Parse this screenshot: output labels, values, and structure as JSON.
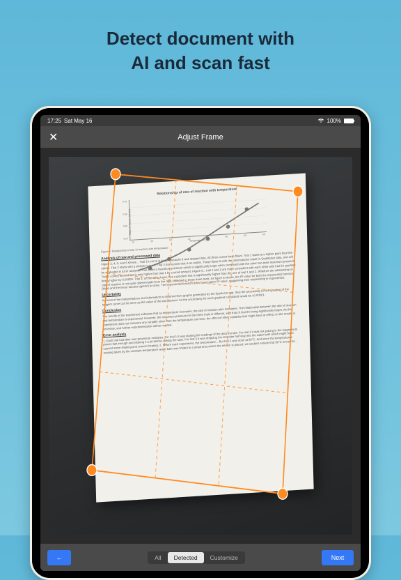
{
  "headline": {
    "line1": "Detect document with",
    "line2": "AI  and scan fast"
  },
  "status_bar": {
    "time": "17:25",
    "date": "Sat May 16",
    "battery_pct": "100%"
  },
  "nav": {
    "title": "Adjust Frame",
    "close_glyph": "✕"
  },
  "segments": {
    "all": "All",
    "detected": "Detected",
    "customize": "Customize"
  },
  "buttons": {
    "back_glyph": "←",
    "next": "Next"
  },
  "document": {
    "chart_caption": "Figure 6: Relationship of rate of reaction with temperature",
    "sec1_heading": "Analysis of raw and processed data",
    "sec1_body": "Figure 3, 4, 5, and 6 shows... Trial 1's curve is longer because it was stopped late. All three curves have flaws. Trial 1 starts at a higher point than the others. Trial 2 starts with a steeper curve... Trial 3 has a point that is an outlier. These flaws fit with the observations made in Qualitative data, and will be evaluated in Error analysis. Trial 3 has a maximum pressure which is significantly large when compared with the other two trials maximum pressure. Trial 2 comes second but is only higher than trial 1 by a small amount. Figure 6... trial 1 and 2 are more consistent with each other with trial 2's gradient being higher by 0.00009. Trial 3, on the other hand, has a gradient that is significantly higher than the one of trial 1 and 2. Whether the relationship of rate of reaction is not quite determinable from the data collected in these three trials. As figure 6 shows, the R² value for both the exponential function (blue) and the linear function (green) is close. The exponential function does have higher R² value, suggesting their relationship is exponential.",
    "sec2_heading": "Uncertainty",
    "sec2_body": "As most of the interpretations and information is obtained from graphs generated by the Sparkvue app, thus the uncertainty for the gradient of the tangent curve can be seen as the value of the last decimal. So the uncertainty for each gradient calculated would be ±0.00001.",
    "sec3_heading": "Conclusion",
    "sec3_body": "The results of the experiment indicates that as temperature increases, the rate of reaction also increases. The relationship between the rate of reaction and temperature is exponential. However, the maximum pressure for the three trials is different, with that of trial 3's being significantly larger. As the experiment does not measure any variable other than the temperature and time, the effect of other variables that might have an effect on the results is uncertain, and further experimentation will be needed.",
    "sec4_heading": "Error analysis",
    "sec4_body": "1. Each trial had their own procedure mistakes. For trial 1 it was starting the readings of the data too late. For trial 2 it was not poking in the magnesium pieces fast enough and shaking it a bit before closing the tube. For trial 3 it was dropping the test tube half way into the water bath which might have caused some shaking and uneven heating. 2. Before each experiment, the temperature... But trial 2 was done at 60°C. And since the temperatures reading taken by the constant temperature water bath was limited to a small area where the sensor is placed, we couldn't ensure that 60°C is true for..."
  },
  "chart_data": {
    "type": "line",
    "title": "Relationship of rate of reaction with temperature",
    "xlabel": "Temperature/°C",
    "ylabel": "Rate of reaction (kPa/s)",
    "x": [
      20,
      25,
      30,
      35,
      40,
      45
    ],
    "values": [
      0.08,
      0.15,
      0.22,
      0.3,
      0.4,
      0.55
    ],
    "xlim": [
      15,
      50
    ],
    "ylim": [
      0,
      0.7
    ],
    "yticks": [
      0,
      0.1,
      0.2,
      0.3,
      0.4,
      0.5,
      0.6,
      0.7
    ],
    "xticks": [
      15,
      20,
      25,
      30,
      35,
      40,
      45,
      50
    ]
  }
}
